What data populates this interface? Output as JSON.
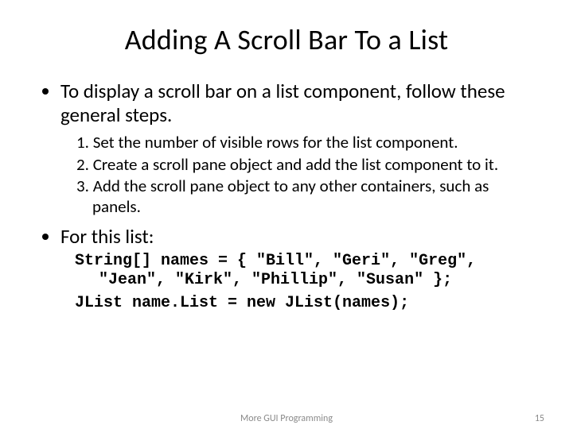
{
  "title": "Adding A Scroll Bar To a List",
  "bullets": {
    "intro": "To display a scroll bar on a list component,  follow these general steps.",
    "steps": [
      "1. Set the number of visible rows for the list component.",
      "2. Create a scroll pane object and add the list component to it.",
      "3. Add the scroll pane object to any other containers, such as panels."
    ],
    "forthis": "For this list:"
  },
  "code": {
    "line1": "String[] names = { \"Bill\", \"Geri\", \"Greg\", \"Jean\", \"Kirk\", \"Phillip\", \"Susan\" };",
    "line2": "JList name.List = new JList(names);"
  },
  "footer": {
    "center": "More GUI Programming",
    "page": "15"
  }
}
